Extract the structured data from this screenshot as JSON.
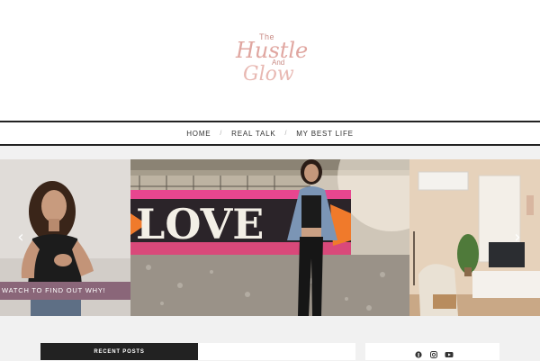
{
  "logo": {
    "the": "The",
    "hustle": "Hustle",
    "and": "And",
    "glow": "Glow"
  },
  "nav": {
    "items": [
      "HOME",
      "REAL TALK",
      "MY BEST LIFE"
    ],
    "separator": "/"
  },
  "slider": {
    "slide1_caption": "WATCH TO FIND OUT WHY!",
    "slide2_sign_text": "LOVE",
    "arrow_left": "‹",
    "arrow_right": "›"
  },
  "sidebar": {
    "recent_posts_title": "RECENT POSTS"
  },
  "social": [
    "pinterest-icon",
    "instagram-icon",
    "youtube-icon"
  ],
  "colors": {
    "logo_pink": "#e0a6a0",
    "caption_bg": "#8a6679",
    "dark_widget": "#222222"
  }
}
